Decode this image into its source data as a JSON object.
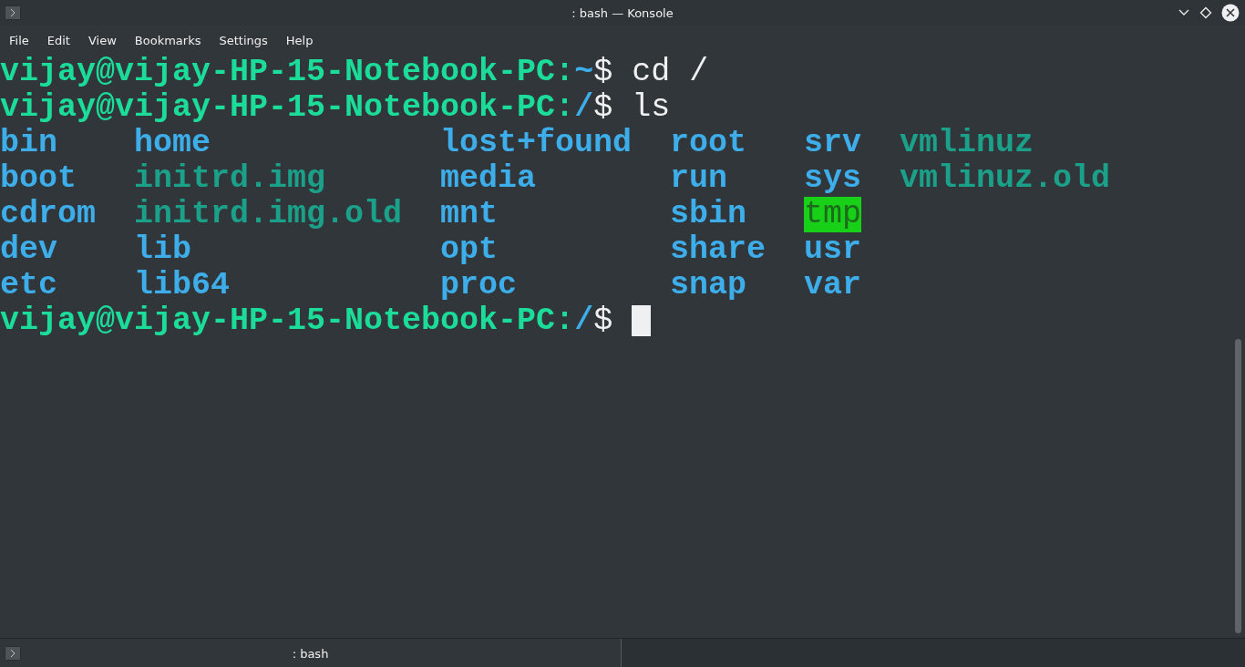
{
  "window": {
    "title": ": bash — Konsole"
  },
  "menu": [
    "File",
    "Edit",
    "View",
    "Bookmarks",
    "Settings",
    "Help"
  ],
  "terminal": {
    "lines": [
      {
        "user_host": "vijay@vijay-HP-15-Notebook-PC",
        "sep": ":",
        "path": "~",
        "symbol": "$",
        "command": "cd /"
      },
      {
        "user_host": "vijay@vijay-HP-15-Notebook-PC",
        "sep": ":",
        "path": "/",
        "symbol": "$",
        "command": "ls"
      }
    ],
    "listing": [
      [
        {
          "name": "bin",
          "kind": "directory"
        },
        {
          "name": "boot",
          "kind": "directory"
        },
        {
          "name": "cdrom",
          "kind": "directory"
        },
        {
          "name": "dev",
          "kind": "directory"
        },
        {
          "name": "etc",
          "kind": "directory"
        }
      ],
      [
        {
          "name": "home",
          "kind": "directory"
        },
        {
          "name": "initrd.img",
          "kind": "symlink"
        },
        {
          "name": "initrd.img.old",
          "kind": "symlink"
        },
        {
          "name": "lib",
          "kind": "directory"
        },
        {
          "name": "lib64",
          "kind": "directory"
        }
      ],
      [
        {
          "name": "lost+found",
          "kind": "directory"
        },
        {
          "name": "media",
          "kind": "directory"
        },
        {
          "name": "mnt",
          "kind": "directory"
        },
        {
          "name": "opt",
          "kind": "directory"
        },
        {
          "name": "proc",
          "kind": "directory"
        }
      ],
      [
        {
          "name": "root",
          "kind": "directory"
        },
        {
          "name": "run",
          "kind": "directory"
        },
        {
          "name": "sbin",
          "kind": "directory"
        },
        {
          "name": "share",
          "kind": "directory"
        },
        {
          "name": "snap",
          "kind": "directory"
        }
      ],
      [
        {
          "name": "srv",
          "kind": "directory"
        },
        {
          "name": "sys",
          "kind": "directory"
        },
        {
          "name": "tmp",
          "kind": "sticky"
        },
        {
          "name": "usr",
          "kind": "directory"
        },
        {
          "name": "var",
          "kind": "directory"
        }
      ],
      [
        {
          "name": "vmlinuz",
          "kind": "symlink"
        },
        {
          "name": "vmlinuz.old",
          "kind": "symlink"
        }
      ]
    ],
    "prompt": {
      "user_host": "vijay@vijay-HP-15-Notebook-PC",
      "sep": ":",
      "path": "/",
      "symbol": "$"
    }
  },
  "tabs": [
    {
      "label": ": bash"
    }
  ]
}
